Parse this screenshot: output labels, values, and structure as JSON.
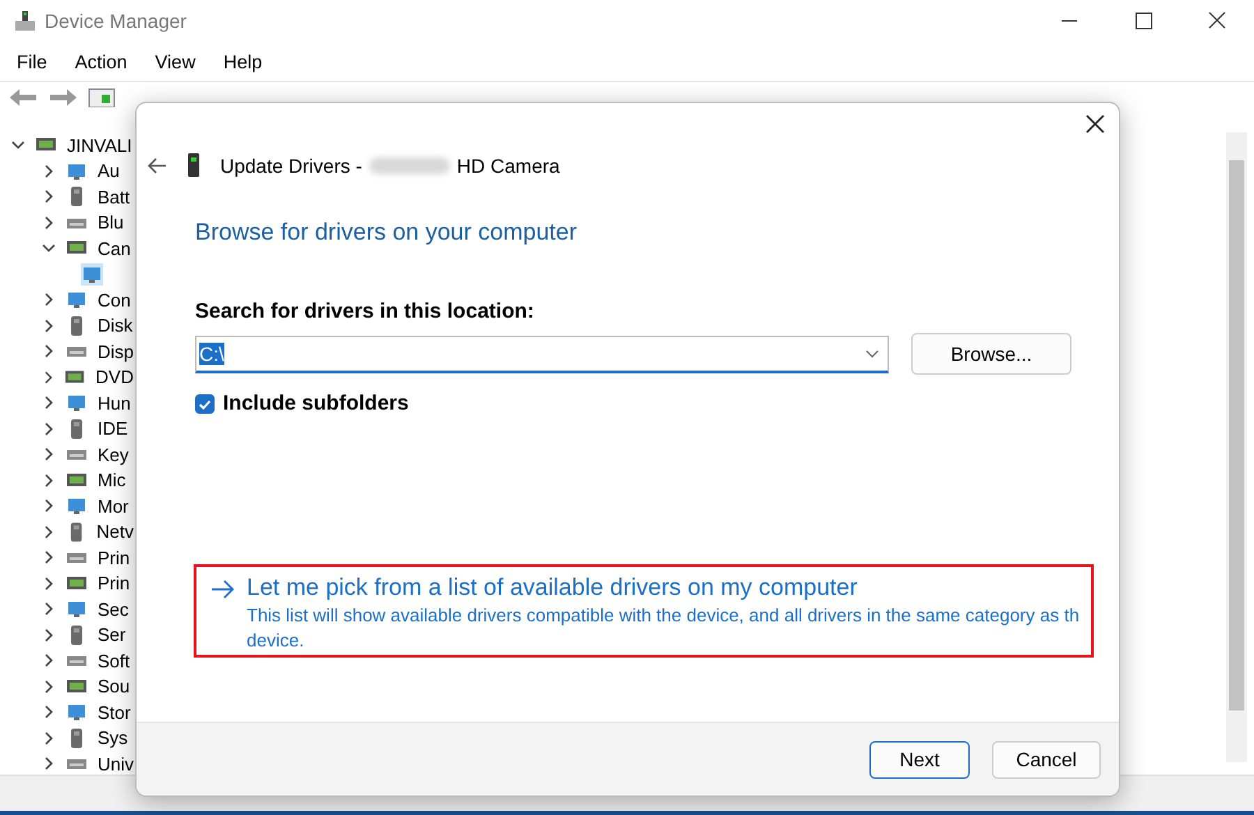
{
  "window": {
    "title": "Device Manager"
  },
  "menu": [
    "File",
    "Action",
    "View",
    "Help"
  ],
  "tree": {
    "label": "JINVALI",
    "expanded": true,
    "selected": false,
    "children": [
      {
        "label": "Au",
        "expanded": false,
        "selected": false
      },
      {
        "label": "Batt",
        "expanded": false,
        "selected": false
      },
      {
        "label": "Blu",
        "expanded": false,
        "selected": false
      },
      {
        "label": "Can",
        "expanded": true,
        "selected": false,
        "children": [
          {
            "selected": true
          }
        ]
      },
      {
        "label": "Con",
        "expanded": false,
        "selected": false
      },
      {
        "label": "Disk",
        "expanded": false,
        "selected": false
      },
      {
        "label": "Disp",
        "expanded": false,
        "selected": false
      },
      {
        "label": "DVD",
        "expanded": false,
        "selected": false
      },
      {
        "label": "Hun",
        "expanded": false,
        "selected": false
      },
      {
        "label": "IDE",
        "expanded": false,
        "selected": false
      },
      {
        "label": "Key",
        "expanded": false,
        "selected": false
      },
      {
        "label": "Mic",
        "expanded": false,
        "selected": false
      },
      {
        "label": "Mor",
        "expanded": false,
        "selected": false
      },
      {
        "label": "Netv",
        "expanded": false,
        "selected": false
      },
      {
        "label": "Prin",
        "expanded": false,
        "selected": false
      },
      {
        "label": "Prin",
        "expanded": false,
        "selected": false
      },
      {
        "label": "Sec",
        "expanded": false,
        "selected": false
      },
      {
        "label": "Ser",
        "expanded": false,
        "selected": false
      },
      {
        "label": "Soft",
        "expanded": false,
        "selected": false
      },
      {
        "label": "Sou",
        "expanded": false,
        "selected": false
      },
      {
        "label": "Stor",
        "expanded": false,
        "selected": false
      },
      {
        "label": "Sys",
        "expanded": false,
        "selected": false
      },
      {
        "label": "Univ",
        "expanded": false,
        "selected": false
      }
    ]
  },
  "dialog": {
    "title_prefix": "Update Drivers -",
    "title_suffix": "HD Camera",
    "heading": "Browse for drivers on your computer",
    "search_label": "Search for drivers in this location:",
    "location": {
      "value": "C:\\",
      "value_selected": true
    },
    "browse_button": "Browse...",
    "include_subfolders": {
      "label": "Include subfolders",
      "checked": true
    },
    "pick_option": {
      "title": "Let me pick from a list of available drivers on my computer",
      "description": [
        "This list will show available drivers compatible with the device, and all drivers in the same category as th",
        "device."
      ],
      "highlighted": true
    },
    "buttons": [
      "Next",
      "Cancel"
    ]
  }
}
